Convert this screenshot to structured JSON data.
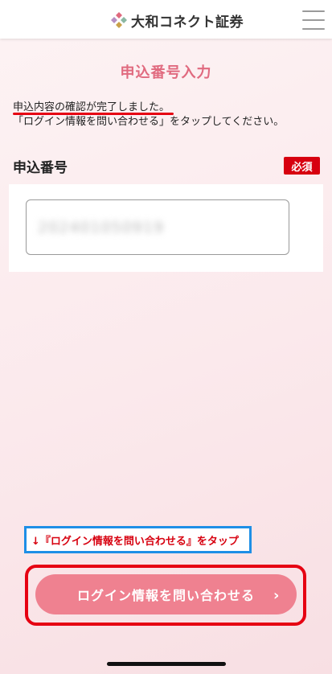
{
  "header": {
    "brand_name": "大和コネクト証券",
    "logo_icon": "daiwa-connect-logo"
  },
  "page": {
    "title": "申込番号入力",
    "notice_line1": "申込内容の確認が完了しました。",
    "notice_line2": "「ログイン情報を問い合わせる」をタップしてください。"
  },
  "form": {
    "field_label": "申込番号",
    "required_badge": "必須",
    "application_number_masked": "202401050919"
  },
  "annotation": {
    "hint": "↓『ログイン情報を問い合わせる』をタップ"
  },
  "cta": {
    "label": "ログイン情報を問い合わせる",
    "chevron": "›"
  },
  "colors": {
    "brand_pink": "#e06a7f",
    "button_pink": "#ef8190",
    "required_red": "#d7000f",
    "highlight_blue": "#1e8fe6"
  }
}
